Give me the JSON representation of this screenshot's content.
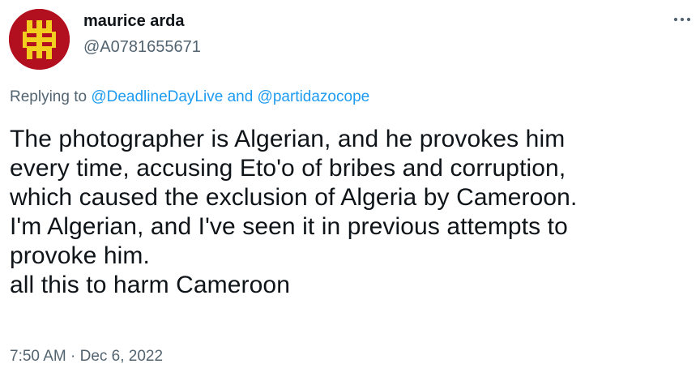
{
  "author": {
    "display_name": "maurice arda",
    "handle": "@A0781655671"
  },
  "reply_context": {
    "prefix": "Replying to",
    "mention_1": "@DeadlineDayLive",
    "conjunction": "and",
    "mention_2": "@partidazocope"
  },
  "tweet": {
    "text": "The photographer is Algerian, and he provokes him\nevery time, accusing Eto'o of bribes and corruption,\nwhich caused the exclusion of Algeria by Cameroon.\nI'm Algerian, and I've seen it in previous attempts to\nprovoke him.\nall this to harm Cameroon"
  },
  "meta": {
    "time": "7:50 AM",
    "separator": "·",
    "date": "Dec 6, 2022"
  },
  "icons": {
    "more": "more-horizontal-icon",
    "avatar_emblem": "amazigh-yaz-symbol"
  },
  "colors": {
    "link": "#1d9bf0",
    "secondary_text": "#536471",
    "primary_text": "#0f1419",
    "avatar_background": "#b3101f",
    "avatar_symbol": "#f2cf1f"
  }
}
